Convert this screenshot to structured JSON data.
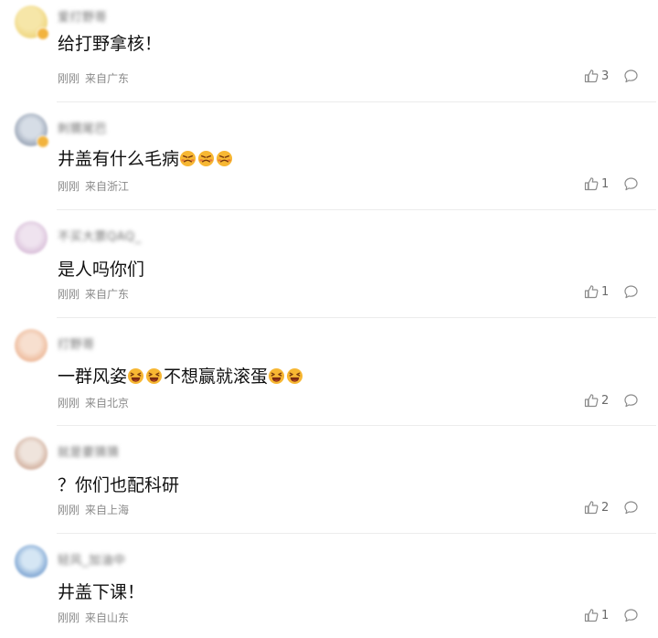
{
  "comments": [
    {
      "username": "爱打野哥",
      "avatar_colors": [
        "#f6e6a8",
        "#e9c85a"
      ],
      "has_badge": true,
      "text": "给打野拿核！",
      "emoji": [],
      "emoji_suffix": "",
      "time": "刚刚",
      "location": "来自广东",
      "likes": "3"
    },
    {
      "username": "刺猬尾巴",
      "avatar_colors": [
        "#d6dde6",
        "#6a7890"
      ],
      "has_badge": true,
      "text": "井盖有什么毛病",
      "emoji": [
        "angry-face-emoji",
        "angry-face-emoji",
        "angry-face-emoji"
      ],
      "emoji_suffix": "",
      "time": "刚刚",
      "location": "来自浙江",
      "likes": "1"
    },
    {
      "username": "不买大票QAQ_",
      "avatar_colors": [
        "#efe3ef",
        "#c7a2c8"
      ],
      "has_badge": false,
      "text": "是人吗你们",
      "emoji": [],
      "emoji_suffix": "",
      "time": "刚刚",
      "location": "来自广东",
      "likes": "1"
    },
    {
      "username": "打野哥",
      "avatar_colors": [
        "#f7dfcf",
        "#e59a6e"
      ],
      "has_badge": false,
      "text": "一群风姿",
      "emoji": [
        "grinning-squint-emoji",
        "grinning-squint-emoji"
      ],
      "text2": "不想赢就滚蛋",
      "emoji2": [
        "grinning-squint-emoji",
        "grinning-squint-emoji"
      ],
      "time": "刚刚",
      "location": "来自北京",
      "likes": "2"
    },
    {
      "username": "就是要猜猜",
      "avatar_colors": [
        "#efe4dc",
        "#b88268"
      ],
      "has_badge": false,
      "text": "？你们也配科研",
      "emoji": [],
      "emoji_suffix": "",
      "time": "刚刚",
      "location": "来自上海",
      "likes": "2"
    },
    {
      "username": "轻风_加油中",
      "avatar_colors": [
        "#d5e6f4",
        "#3a72b8"
      ],
      "has_badge": false,
      "text": "井盖下课！",
      "emoji": [],
      "emoji_suffix": "",
      "time": "刚刚",
      "location": "来自山东",
      "likes": "1"
    }
  ],
  "icons": {
    "like": "thumbs-up-icon",
    "reply": "comment-bubble-icon"
  },
  "colors": {
    "text": "#111111",
    "meta": "#8a8a8a",
    "divider": "#ececec",
    "icon": "#8c8c8c",
    "emoji_face": "#f7b733",
    "emoji_blush": "#e0533a"
  }
}
